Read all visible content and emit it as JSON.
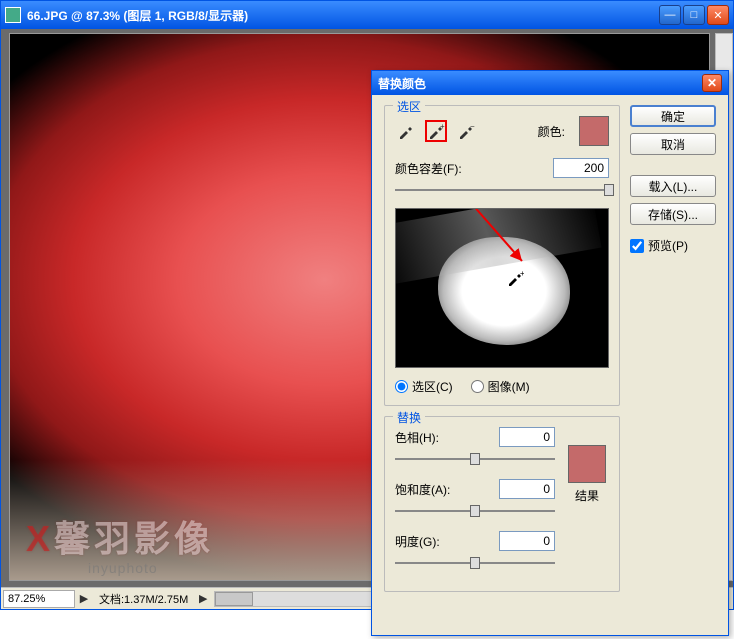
{
  "main_window": {
    "title": "66.JPG @ 87.3% (图层 1, RGB/8/显示器)",
    "statusbar": {
      "zoom": "87.25%",
      "doc_info": "文档:1.37M/2.75M"
    },
    "watermark": {
      "cn": "馨羽影像",
      "en": "inyuphoto"
    }
  },
  "dialog": {
    "title": "替换颜色",
    "buttons": {
      "ok": "确定",
      "cancel": "取消",
      "load": "载入(L)...",
      "save": "存储(S)..."
    },
    "preview_check": "预览(P)",
    "selection": {
      "legend": "选区",
      "color_label": "颜色:",
      "color_swatch_hex": "#c46a6a",
      "fuzz_label": "颜色容差(F):",
      "fuzz_value": "200",
      "fuzz_slider_pct": 100,
      "radio_selection": "选区(C)",
      "radio_image": "图像(M)",
      "radio_checked": "selection"
    },
    "replace": {
      "legend": "替换",
      "hue_label": "色相(H):",
      "hue_value": "0",
      "hue_slider_pct": 50,
      "sat_label": "饱和度(A):",
      "sat_value": "0",
      "sat_slider_pct": 50,
      "lig_label": "明度(G):",
      "lig_value": "0",
      "lig_slider_pct": 50,
      "result_label": "结果",
      "result_swatch_hex": "#c46a6a"
    }
  }
}
